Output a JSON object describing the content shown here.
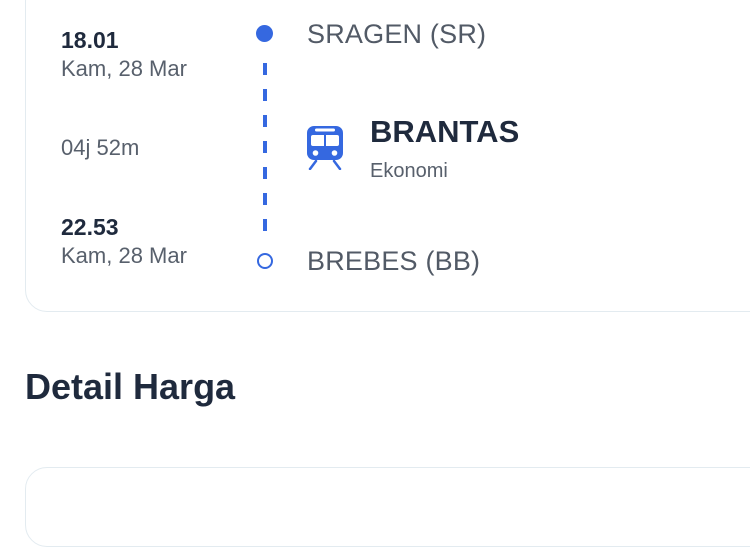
{
  "journey": {
    "departure": {
      "time": "18.01",
      "date": "Kam, 28 Mar",
      "station": "SRAGEN (SR)"
    },
    "duration": "04j 52m",
    "arrival": {
      "time": "22.53",
      "date": "Kam, 28 Mar",
      "station": "BREBES (BB)"
    },
    "train": {
      "name": "BRANTAS",
      "class": "Ekonomi",
      "icon": "train-icon"
    }
  },
  "price_section": {
    "title": "Detail Harga"
  },
  "colors": {
    "accent": "#3568e0",
    "text_dark": "#1f2a3d",
    "text_muted": "#58606c",
    "card_border": "#e3ebf0"
  }
}
